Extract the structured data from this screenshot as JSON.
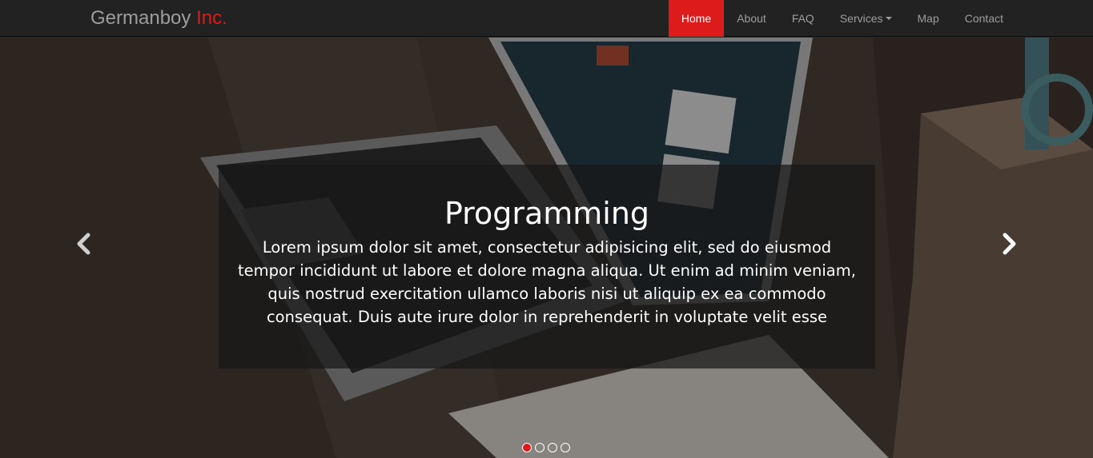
{
  "brand": {
    "name": "Germanboy",
    "accent": "Inc."
  },
  "nav": {
    "home": "Home",
    "about": "About",
    "faq": "FAQ",
    "services": "Services",
    "map": "Map",
    "contact": "Contact"
  },
  "slide": {
    "title": "Programming",
    "text": "Lorem ipsum dolor sit amet, consectetur adipisicing elit, sed do eiusmod tempor incididunt ut labore et dolore magna aliqua. Ut enim ad minim veniam, quis nostrud exercitation ullamco laboris nisi ut aliquip ex ea commodo consequat. Duis aute irure dolor in reprehenderit in voluptate velit esse"
  },
  "carousel": {
    "slide_count": 4,
    "active_index": 0
  },
  "icons": {
    "prev": "chevron-left-icon",
    "next": "chevron-right-icon",
    "dropdown": "caret-down-icon"
  },
  "colors": {
    "accent": "#dd1b1b",
    "navbar": "#222222",
    "nav_text": "#9d9d9d"
  }
}
